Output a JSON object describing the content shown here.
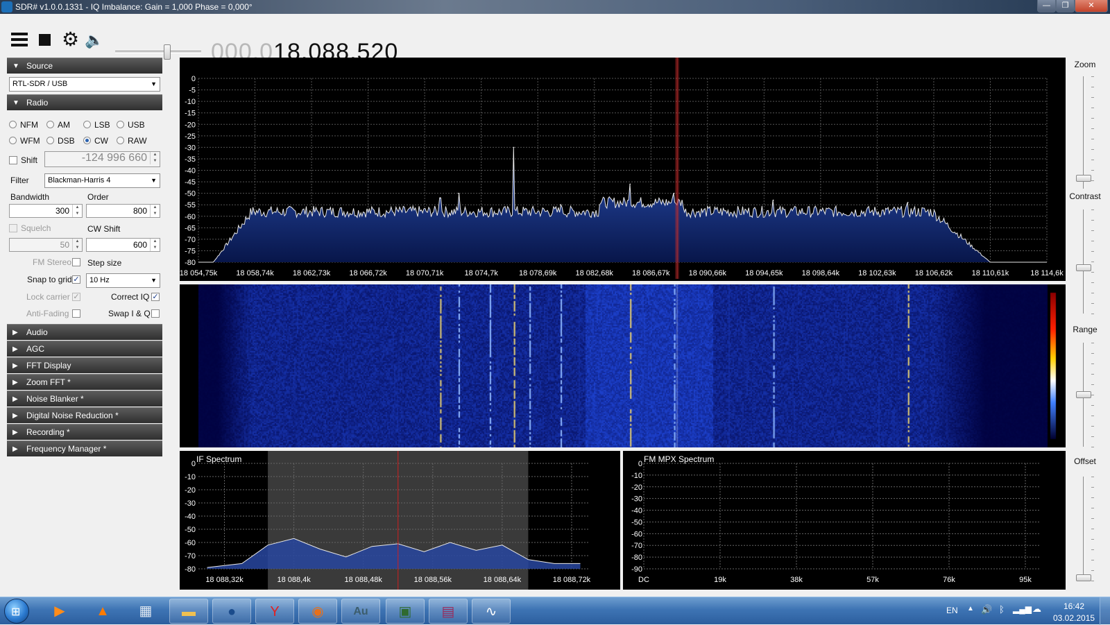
{
  "window": {
    "title": "SDR# v1.0.0.1331 - IQ Imbalance: Gain = 1,000 Phase = 0,000°",
    "min": "—",
    "max": "❐",
    "close": "✕"
  },
  "toolbar": {
    "frequency_dim": "000.0",
    "frequency_main": "18.088.520",
    "volume_level": 0.6
  },
  "left": {
    "source_header": "Source",
    "source_device": "RTL-SDR / USB",
    "radio_header": "Radio",
    "modes": [
      "NFM",
      "AM",
      "LSB",
      "USB",
      "WFM",
      "DSB",
      "CW",
      "RAW"
    ],
    "selected_mode": "CW",
    "shift_label": "Shift",
    "shift_value": "-124 996 660",
    "filter_label": "Filter",
    "filter_value": "Blackman-Harris 4",
    "bandwidth_label": "Bandwidth",
    "bandwidth_value": "300",
    "order_label": "Order",
    "order_value": "800",
    "squelch_label": "Squelch",
    "squelch_value": "50",
    "cwshift_label": "CW Shift",
    "cwshift_value": "600",
    "fmstereo_label": "FM Stereo",
    "stepsize_label": "Step size",
    "snap_label": "Snap to grid",
    "step_value": "10 Hz",
    "lockcarrier_label": "Lock carrier",
    "correctiq_label": "Correct IQ",
    "antifading_label": "Anti-Fading",
    "swapiq_label": "Swap I & Q",
    "collapsed_sections": [
      "Audio",
      "AGC",
      "FFT Display",
      "Zoom FFT *",
      "Noise Blanker *",
      "Digital Noise Reduction *",
      "Recording *",
      "Frequency Manager *"
    ]
  },
  "right": {
    "zoom_label": "Zoom",
    "contrast_label": "Contrast",
    "range_label": "Range",
    "offset_label": "Offset"
  },
  "chart_data": [
    {
      "type": "line",
      "name": "main-spectrum",
      "ylim": [
        -80,
        0
      ],
      "yticks": [
        "0",
        "-5",
        "-10",
        "-15",
        "-20",
        "-25",
        "-30",
        "-35",
        "-40",
        "-45",
        "-50",
        "-55",
        "-60",
        "-65",
        "-70",
        "-75",
        "-80"
      ],
      "xticks": [
        "18 054,75k",
        "18 058,74k",
        "18 062,73k",
        "18 066,72k",
        "18 070,71k",
        "18 074,7k",
        "18 078,69k",
        "18 082,68k",
        "18 086,67k",
        "18 090,66k",
        "18 094,65k",
        "18 098,64k",
        "18 102,63k",
        "18 106,62k",
        "18 110,61k",
        "18 114,6k"
      ],
      "tuned_marker_khz": 18088.52,
      "peaks": [
        {
          "x_khz": 18071.8,
          "y_db": -52
        },
        {
          "x_khz": 18073.1,
          "y_db": -50
        },
        {
          "x_khz": 18077.0,
          "y_db": -30
        },
        {
          "x_khz": 18080.3,
          "y_db": -55
        },
        {
          "x_khz": 18085.2,
          "y_db": -46
        },
        {
          "x_khz": 18088.3,
          "y_db": -50
        },
        {
          "x_khz": 18095.3,
          "y_db": -53
        },
        {
          "x_khz": 18104.8,
          "y_db": -54
        }
      ],
      "noise_floor_db": -58
    },
    {
      "type": "line",
      "name": "if-spectrum",
      "title": "IF Spectrum",
      "ylim": [
        -80,
        0
      ],
      "yticks": [
        "0",
        "-10",
        "-20",
        "-30",
        "-40",
        "-50",
        "-60",
        "-70",
        "-80"
      ],
      "xticks": [
        "18 088,32k",
        "18 088,4k",
        "18 088,48k",
        "18 088,56k",
        "18 088,64k",
        "18 088,72k"
      ],
      "passband_khz": [
        18088.37,
        18088.67
      ],
      "marker_khz": 18088.52,
      "x_khz": [
        18088.3,
        18088.34,
        18088.37,
        18088.4,
        18088.43,
        18088.46,
        18088.49,
        18088.52,
        18088.55,
        18088.58,
        18088.61,
        18088.64,
        18088.67,
        18088.7,
        18088.73
      ],
      "y_db": [
        -79,
        -76,
        -62,
        -57,
        -65,
        -71,
        -63,
        -61,
        -67,
        -60,
        -66,
        -62,
        -73,
        -76,
        -76
      ]
    },
    {
      "type": "line",
      "name": "fm-mpx-spectrum",
      "title": "FM MPX Spectrum",
      "ylim": [
        -90,
        0
      ],
      "yticks": [
        "0",
        "-10",
        "-20",
        "-30",
        "-40",
        "-50",
        "-60",
        "-70",
        "-80",
        "-90"
      ],
      "xticks": [
        "DC",
        "19k",
        "38k",
        "57k",
        "76k",
        "95k"
      ]
    }
  ],
  "taskbar": {
    "start": "⊞",
    "apps": [
      {
        "name": "media-player",
        "glyph": "▶",
        "color": "#ff8c1a"
      },
      {
        "name": "vlc",
        "glyph": "▲",
        "color": "#ff7b00"
      },
      {
        "name": "calculator",
        "glyph": "▦",
        "color": "#dde6f0"
      },
      {
        "name": "explorer",
        "glyph": "▬",
        "color": "#f0c050"
      },
      {
        "name": "globe",
        "glyph": "●",
        "color": "#1b4c8c"
      },
      {
        "name": "yandex",
        "glyph": "Y",
        "color": "#e22020"
      },
      {
        "name": "firefox",
        "glyph": "◉",
        "color": "#e8701a"
      },
      {
        "name": "audition",
        "glyph": "Au",
        "color": "#3c5d6c"
      },
      {
        "name": "monitor",
        "glyph": "▣",
        "color": "#2f6a2f"
      },
      {
        "name": "winrar",
        "glyph": "▤",
        "color": "#9a2a5a"
      },
      {
        "name": "sdrsharp",
        "glyph": "∿",
        "color": "#ffffff"
      }
    ],
    "lang": "EN",
    "time": "16:42",
    "date": "03.02.2015"
  }
}
